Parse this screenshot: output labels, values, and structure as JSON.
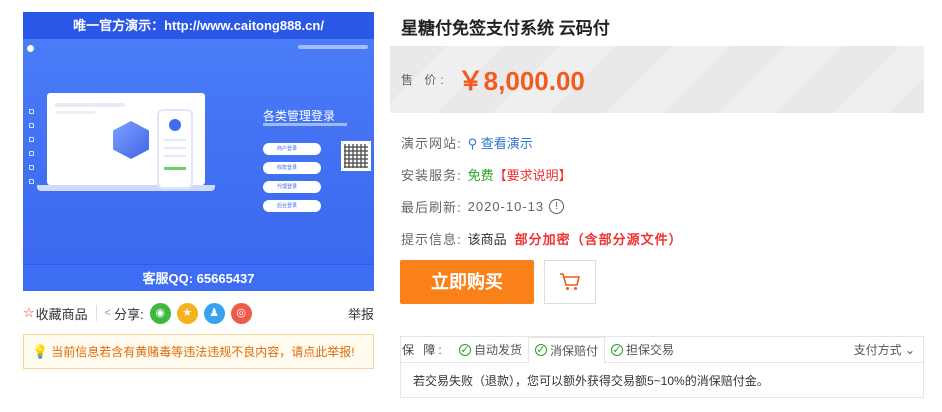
{
  "product_image": {
    "top_text": "唯一官方演示：http://www.caitong888.cn/",
    "bottom_text": "客服QQ: 65665437",
    "login_title": "各类管理登录",
    "login_buttons": [
      "商户登录",
      "收款登录",
      "代理登录",
      "后台登录"
    ]
  },
  "actions": {
    "favorite": "收藏商品",
    "share_label": "分享:",
    "social_icons": [
      "wechat-icon",
      "qzone-icon",
      "qq-icon",
      "weibo-icon"
    ],
    "report": "举报"
  },
  "notice": {
    "text": "当前信息若含有黄赌毒等违法违规不良内容，请点此举报!"
  },
  "product": {
    "title": "星糖付免签支付系统 云码付",
    "price_label": "售 价:",
    "price": "￥8,000.00",
    "demo_label": "演示网站:",
    "demo_link": "查看演示",
    "install_label": "安装服务:",
    "install_value": "免费",
    "install_req": "【要求说明】",
    "refresh_label": "最后刷新:",
    "refresh_date": "2020-10-13",
    "tip_label": "提示信息:",
    "tip_prefix": "该商品",
    "tip_value": "部分加密（含部分源文件）"
  },
  "buttons": {
    "buy": "立即购买"
  },
  "guarantee": {
    "label": "保 障:",
    "tabs": [
      "自动发货",
      "消保赔付",
      "担保交易"
    ],
    "active_tab": "消保赔付",
    "pay_methods": "支付方式",
    "body": "若交易失败（退款），您可以额外获得交易额5~10%的消保赔付金。"
  },
  "colors": {
    "accent": "#fa8019",
    "price": "#f25a1e",
    "link": "#2f74d0",
    "danger": "#ee3333",
    "success": "#27a327",
    "image_blue": "#3d6df2"
  }
}
